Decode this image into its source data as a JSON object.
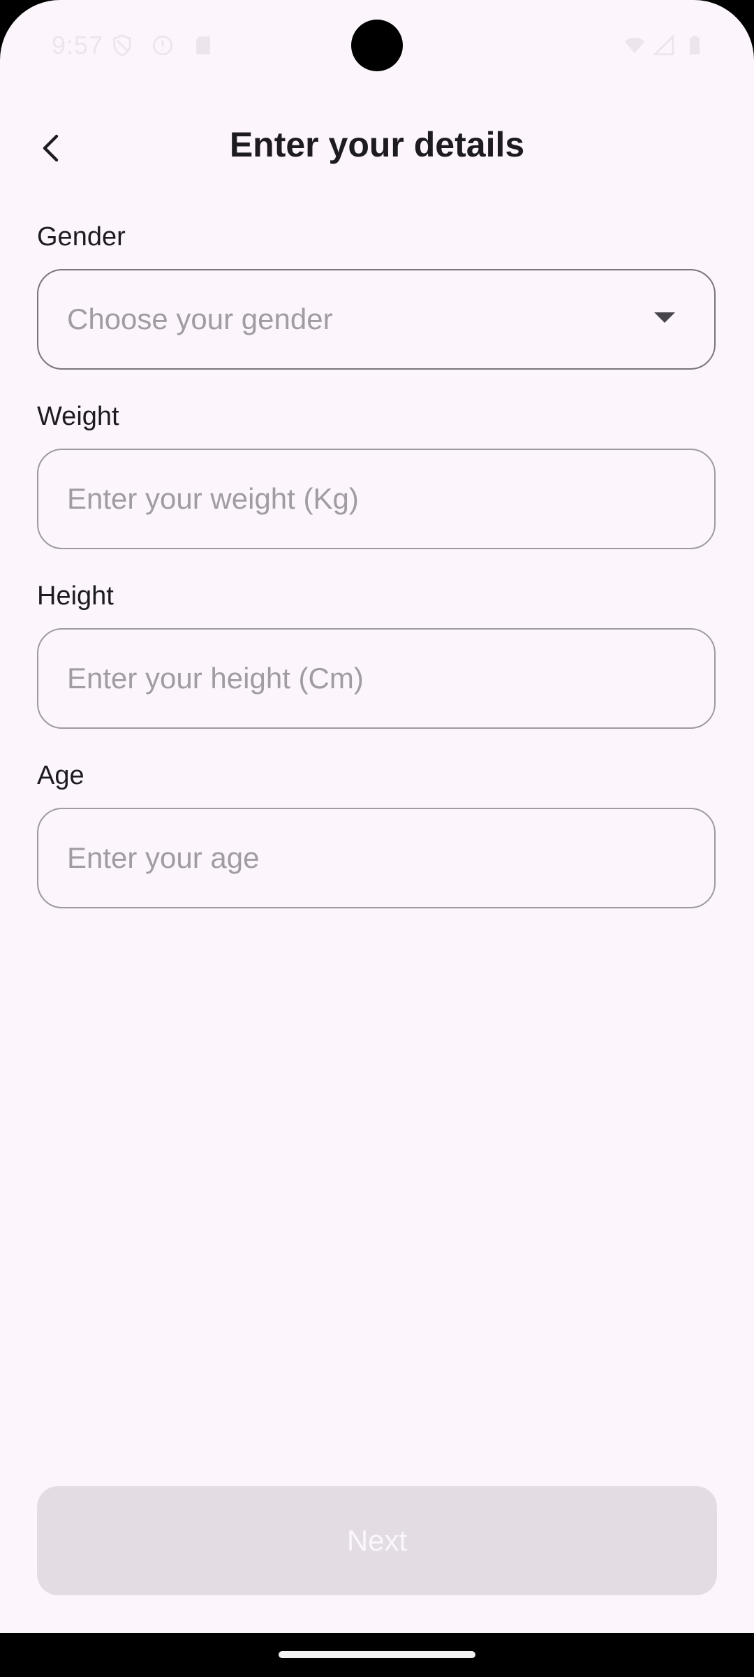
{
  "status_bar": {
    "time": "9:57",
    "icons": [
      "shield-icon",
      "alert-circle-icon",
      "sd-card-icon",
      "wifi-icon",
      "signal-icon",
      "battery-icon"
    ]
  },
  "app_bar": {
    "back_icon": "chevron-left-icon",
    "title": "Enter your details"
  },
  "form": {
    "gender": {
      "label": "Gender",
      "placeholder": "Choose your gender",
      "icon": "dropdown-arrow-icon"
    },
    "weight": {
      "label": "Weight",
      "placeholder": "Enter your weight (Kg)"
    },
    "height": {
      "label": "Height",
      "placeholder": "Enter your height (Cm)"
    },
    "age": {
      "label": "Age",
      "placeholder": "Enter your age"
    }
  },
  "footer": {
    "next_label": "Next"
  },
  "colors": {
    "background": "#FCF6FC",
    "title_text": "#1D1B20",
    "placeholder_text": "#A09CA2",
    "field_border": "#9E9A9E",
    "button_disabled_bg": "#E3DDE3",
    "button_disabled_text": "#FBF6FB"
  }
}
